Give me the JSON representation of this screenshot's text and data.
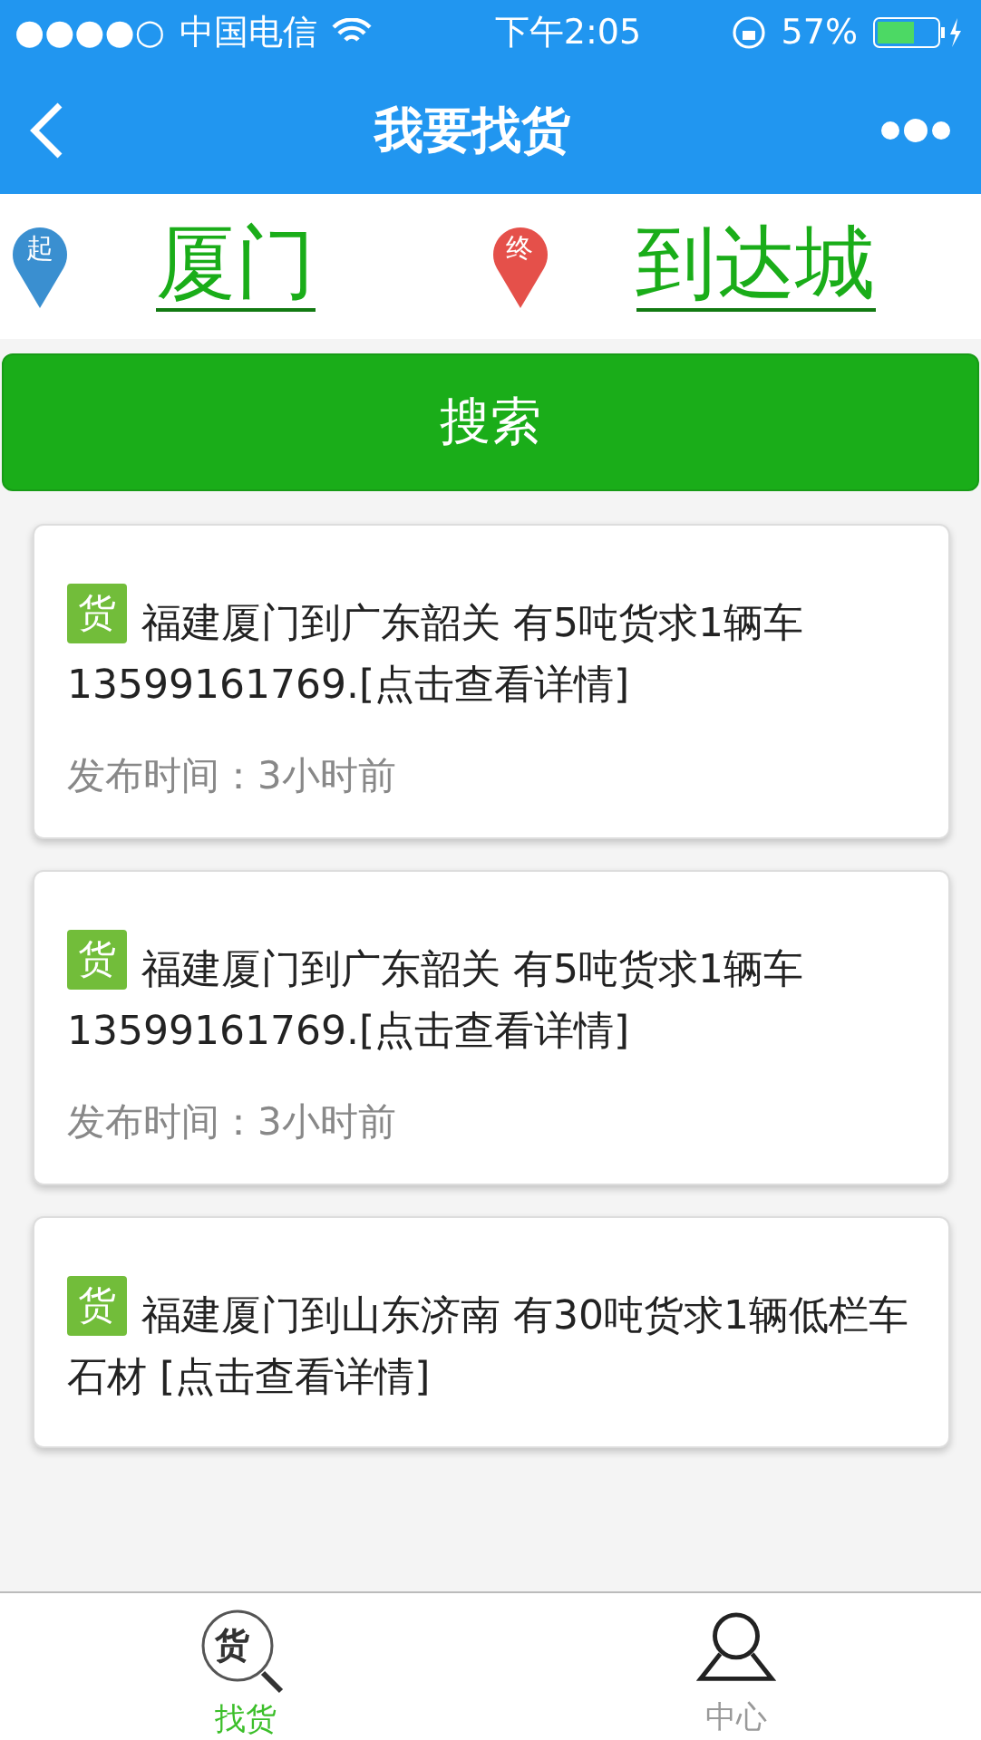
{
  "status_bar": {
    "signal": "●●●●○",
    "carrier": "中国电信",
    "time": "下午2:05",
    "battery": "57%"
  },
  "nav": {
    "title": "我要找货"
  },
  "route": {
    "from": {
      "badge": "起",
      "city": "厦门"
    },
    "to": {
      "badge": "终",
      "city": "到达城"
    }
  },
  "search_button": "搜索",
  "cards": [
    {
      "badge": "货",
      "title": "福建厦门到广东韶关 有5吨货求1辆车 13599161769.[点击查看详情]",
      "time": "发布时间：3小时前"
    },
    {
      "badge": "货",
      "title": "福建厦门到广东韶关 有5吨货求1辆车 13599161769.[点击查看详情]",
      "time": "发布时间：3小时前"
    },
    {
      "badge": "货",
      "title": "福建厦门到山东济南 有30吨货求1辆低栏车石材 [点击查看详情]"
    }
  ],
  "tabs": [
    {
      "kind": "goods",
      "icon_text": "货",
      "label": "找货",
      "selected": true
    },
    {
      "kind": "person",
      "label": "中心",
      "selected": false
    }
  ]
}
